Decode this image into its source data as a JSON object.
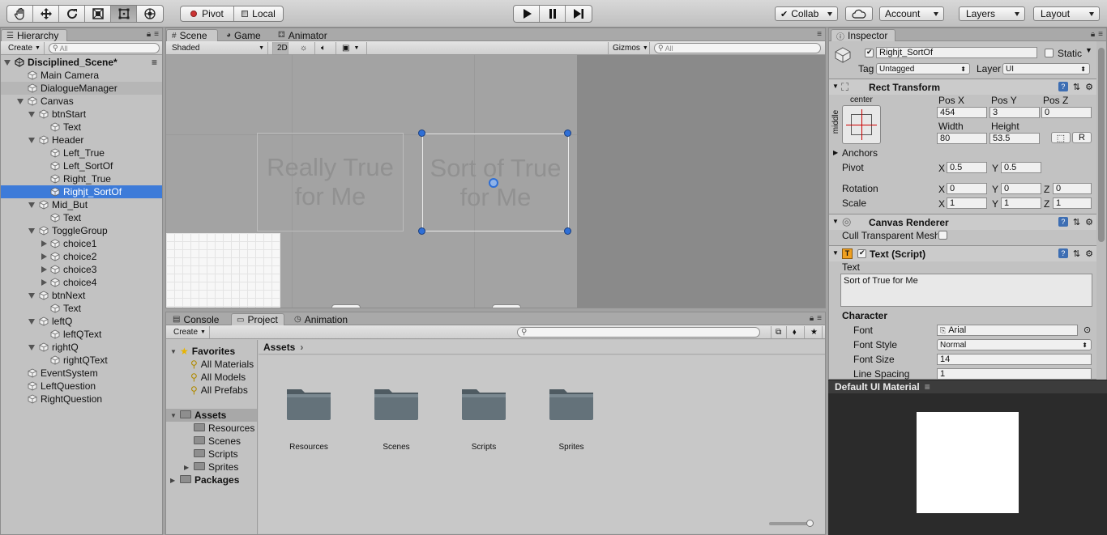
{
  "toolbar": {
    "tools": [
      "hand-tool-icon",
      "move-tool-icon",
      "rotate-tool-icon",
      "scale-tool-icon",
      "rect-tool-icon",
      "transform-tool-icon"
    ],
    "pivot_label": "Pivot",
    "local_label": "Local",
    "collab_label": "Collab",
    "account_label": "Account",
    "layers_label": "Layers",
    "layout_label": "Layout"
  },
  "hierarchy": {
    "tab_label": "Hierarchy",
    "create_label": "Create",
    "search_placeholder": "All",
    "scene_name": "Disciplined_Scene*",
    "items": [
      {
        "label": "Main Camera",
        "depth": 1,
        "arrow": "none",
        "state": ""
      },
      {
        "label": "DialogueManager",
        "depth": 1,
        "arrow": "none",
        "state": "hl"
      },
      {
        "label": "Canvas",
        "depth": 1,
        "arrow": "open",
        "state": ""
      },
      {
        "label": "btnStart",
        "depth": 2,
        "arrow": "open",
        "state": ""
      },
      {
        "label": "Text",
        "depth": 3,
        "arrow": "none",
        "state": ""
      },
      {
        "label": "Header",
        "depth": 2,
        "arrow": "open",
        "state": ""
      },
      {
        "label": "Left_True",
        "depth": 3,
        "arrow": "none",
        "state": ""
      },
      {
        "label": "Left_SortOf",
        "depth": 3,
        "arrow": "none",
        "state": ""
      },
      {
        "label": "Right_True",
        "depth": 3,
        "arrow": "none",
        "state": ""
      },
      {
        "label": "Righjt_SortOf",
        "depth": 3,
        "arrow": "none",
        "state": "sel"
      },
      {
        "label": "Mid_But",
        "depth": 2,
        "arrow": "open",
        "state": ""
      },
      {
        "label": "Text",
        "depth": 3,
        "arrow": "none",
        "state": ""
      },
      {
        "label": "ToggleGroup",
        "depth": 2,
        "arrow": "open",
        "state": ""
      },
      {
        "label": "choice1",
        "depth": 3,
        "arrow": "closed",
        "state": ""
      },
      {
        "label": "choice2",
        "depth": 3,
        "arrow": "closed",
        "state": ""
      },
      {
        "label": "choice3",
        "depth": 3,
        "arrow": "closed",
        "state": ""
      },
      {
        "label": "choice4",
        "depth": 3,
        "arrow": "closed",
        "state": ""
      },
      {
        "label": "btnNext",
        "depth": 2,
        "arrow": "open",
        "state": ""
      },
      {
        "label": "Text",
        "depth": 3,
        "arrow": "none",
        "state": ""
      },
      {
        "label": "leftQ",
        "depth": 2,
        "arrow": "open",
        "state": ""
      },
      {
        "label": "leftQText",
        "depth": 3,
        "arrow": "none",
        "state": ""
      },
      {
        "label": "rightQ",
        "depth": 2,
        "arrow": "open",
        "state": ""
      },
      {
        "label": "rightQText",
        "depth": 3,
        "arrow": "none",
        "state": ""
      },
      {
        "label": "EventSystem",
        "depth": 1,
        "arrow": "none",
        "state": ""
      },
      {
        "label": "LeftQuestion",
        "depth": 1,
        "arrow": "none",
        "state": ""
      },
      {
        "label": "RightQuestion",
        "depth": 1,
        "arrow": "none",
        "state": ""
      }
    ]
  },
  "scene": {
    "tabs": [
      "Scene",
      "Game",
      "Animator"
    ],
    "shading_mode": "Shaded",
    "mode_2d_label": "2D",
    "gizmos_label": "Gizmos",
    "search_placeholder": "All",
    "text_left": "Really True for Me",
    "text_selected": "Sort of True for Me"
  },
  "project": {
    "tabs": [
      "Console",
      "Project",
      "Animation"
    ],
    "create_label": "Create",
    "tree": [
      {
        "label": "Favorites",
        "kind": "header",
        "depth": 0
      },
      {
        "label": "All Materials",
        "kind": "search",
        "depth": 1
      },
      {
        "label": "All Models",
        "kind": "search",
        "depth": 1
      },
      {
        "label": "All Prefabs",
        "kind": "search",
        "depth": 1
      },
      {
        "label": "Assets",
        "kind": "root-selected",
        "depth": 0
      },
      {
        "label": "Resources",
        "kind": "folder",
        "depth": 1
      },
      {
        "label": "Scenes",
        "kind": "folder",
        "depth": 1
      },
      {
        "label": "Scripts",
        "kind": "folder",
        "depth": 1
      },
      {
        "label": "Sprites",
        "kind": "folder-closed",
        "depth": 1
      },
      {
        "label": "Packages",
        "kind": "root",
        "depth": 0
      }
    ],
    "breadcrumb": "Assets",
    "folders": [
      "Resources",
      "Scenes",
      "Scripts",
      "Sprites"
    ]
  },
  "inspector": {
    "tab_label": "Inspector",
    "object_name": "Righjt_SortOf",
    "static_label": "Static",
    "tag_label": "Tag",
    "tag_value": "Untagged",
    "layer_label": "Layer",
    "layer_value": "UI",
    "rect_transform": {
      "title": "Rect Transform",
      "anchor_h": "center",
      "anchor_v": "middle",
      "pos_x_label": "Pos X",
      "pos_x": "454",
      "pos_y_label": "Pos Y",
      "pos_y": "3",
      "pos_z_label": "Pos Z",
      "pos_z": "0",
      "width_label": "Width",
      "width": "80",
      "height_label": "Height",
      "height": "53.5",
      "r_label": "R",
      "anchors_label": "Anchors",
      "pivot_label": "Pivot",
      "pivot_x": "0.5",
      "pivot_y": "0.5",
      "rotation_label": "Rotation",
      "rot_x": "0",
      "rot_y": "0",
      "rot_z": "0",
      "scale_label": "Scale",
      "scale_x": "1",
      "scale_y": "1",
      "scale_z": "1",
      "x": "X",
      "y": "Y",
      "z": "Z"
    },
    "canvas_renderer": {
      "title": "Canvas Renderer",
      "cull_label": "Cull Transparent Mesh"
    },
    "text_script": {
      "title": "Text (Script)",
      "text_label": "Text",
      "text_value": "Sort of True for Me",
      "character_label": "Character",
      "font_label": "Font",
      "font_value": "Arial",
      "font_style_label": "Font Style",
      "font_style_value": "Normal",
      "font_size_label": "Font Size",
      "font_size_value": "14",
      "line_spacing_label": "Line Spacing",
      "line_spacing_value": "1"
    },
    "material_label": "Default UI Material"
  }
}
